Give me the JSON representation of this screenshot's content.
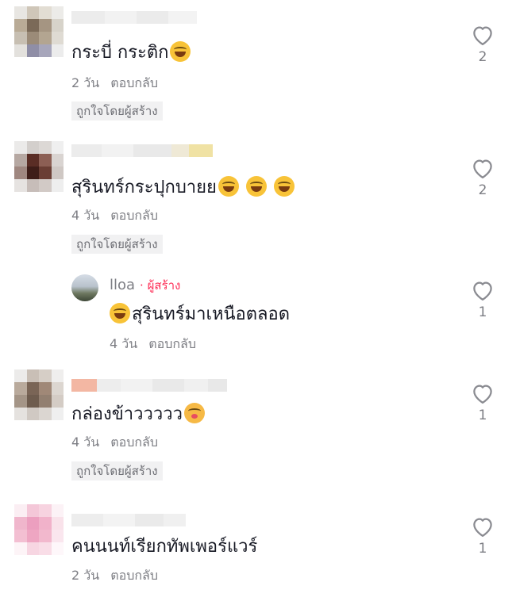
{
  "comments": [
    {
      "text": "กระบี่ กระติก",
      "emojis": [
        "tears-of-joy-emoji"
      ],
      "time": "2 วัน",
      "reply_label": "ตอบกลับ",
      "badge": "ถูกใจโดยผู้สร้าง",
      "likes": "2"
    },
    {
      "text": "สุรินทร์กระปุกบายย",
      "emojis": [
        "tears-of-joy-emoji",
        "tears-of-joy-emoji",
        "tears-of-joy-emoji"
      ],
      "time": "4 วัน",
      "reply_label": "ตอบกลับ",
      "badge": "ถูกใจโดยผู้สร้าง",
      "likes": "2",
      "reply": {
        "username": "lloa",
        "creator_tag": "ผู้สร้าง",
        "text": "สุรินทร์มาเหนือตลอด",
        "emojis": [
          "tears-of-joy-emoji"
        ],
        "time": "4 วัน",
        "reply_label": "ตอบกลับ",
        "likes": "1"
      }
    },
    {
      "text": "กล่องข้าววววว",
      "emojis": [
        "smiling-face-with-hearts-emoji"
      ],
      "time": "4 วัน",
      "reply_label": "ตอบกลับ",
      "badge": "ถูกใจโดยผู้สร้าง",
      "likes": "1"
    },
    {
      "text": "คนนนท์เรียกทัพเพอร์แวร์",
      "emojis": [],
      "time": "2 วัน",
      "reply_label": "ตอบกลับ",
      "likes": "1"
    }
  ],
  "colors": {
    "text": "#161823",
    "secondary": "#7d7e84",
    "creator_tag": "#fe2c55",
    "badge_bg": "#f1f1f2"
  },
  "icons": {
    "like": "heart-outline-icon"
  }
}
